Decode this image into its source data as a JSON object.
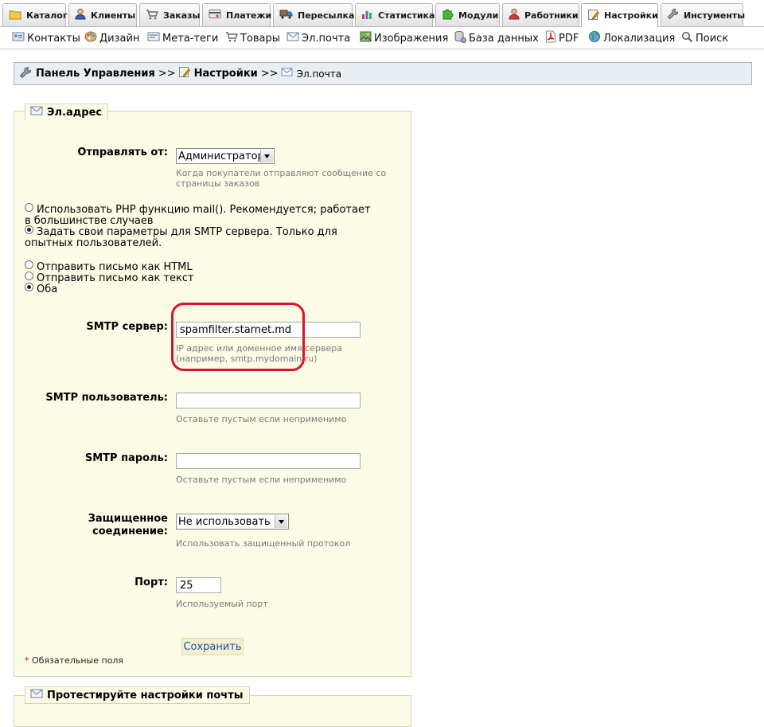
{
  "tabs": [
    {
      "label": "Каталог",
      "icon": "folder-icon"
    },
    {
      "label": "Клиенты",
      "icon": "user-icon"
    },
    {
      "label": "Заказы",
      "icon": "cart-icon"
    },
    {
      "label": "Платежи",
      "icon": "payment-icon"
    },
    {
      "label": "Пересылка",
      "icon": "truck-icon"
    },
    {
      "label": "Статистика",
      "icon": "chart-icon"
    },
    {
      "label": "Модули",
      "icon": "puzzle-icon"
    },
    {
      "label": "Работники",
      "icon": "worker-icon"
    },
    {
      "label": "Настройки",
      "icon": "settings-page-icon",
      "active": true
    },
    {
      "label": "Инстументы",
      "icon": "wrench-icon"
    }
  ],
  "submenu": [
    {
      "label": "Контакты",
      "icon": "contacts-icon"
    },
    {
      "label": "Дизайн",
      "icon": "palette-icon"
    },
    {
      "label": "Мета-теги",
      "icon": "meta-tags-icon"
    },
    {
      "label": "Товары",
      "icon": "cart-icon"
    },
    {
      "label": "Эл.почта",
      "icon": "envelope-icon"
    },
    {
      "label": "Изображения",
      "icon": "image-icon"
    },
    {
      "label": "База данных",
      "icon": "database-icon"
    },
    {
      "label": "PDF",
      "icon": "pdf-icon"
    },
    {
      "label": "Локализация",
      "icon": "globe-icon"
    },
    {
      "label": "Поиск",
      "icon": "search-icon"
    }
  ],
  "breadcrumb": {
    "root": "Панель Управления",
    "separator": ">>",
    "section": "Настройки",
    "current": "Эл.почта"
  },
  "form": {
    "legend": "Эл.адрес",
    "send_from": {
      "label": "Отправлять от:",
      "value": "Администратор",
      "hint": "Когда покупатели отправляют сообщение со страницы заказов"
    },
    "mail_method": [
      {
        "label": "Использовать PHP функцию mail(). Рекомендуется; работает в большинстве случаев",
        "checked": false
      },
      {
        "label": "Задать свои параметры для SMTP сервера. Только для опытных пользователей.",
        "checked": true
      }
    ],
    "mail_format": [
      {
        "label": "Отправить письмо как HTML",
        "checked": false
      },
      {
        "label": "Отправить письмо как текст",
        "checked": false
      },
      {
        "label": "Оба",
        "checked": true
      }
    ],
    "smtp_server": {
      "label": "SMTP сервер:",
      "value": "spamfilter.starnet.md",
      "hint": "IP адрес или доменное имя сервера (например, smtp.mydomain.ru)"
    },
    "smtp_user": {
      "label": "SMTP пользователь:",
      "value": "",
      "hint": "Оставьте пустым если неприменимо"
    },
    "smtp_password": {
      "label": "SMTP пароль:",
      "value": "",
      "hint": "Оставьте пустым если неприменимо"
    },
    "secure": {
      "label_line1": "Защищенное",
      "label_line2": "соединение:",
      "value": "Не использовать",
      "hint": "Использовать защищенный протокол"
    },
    "port": {
      "label": "Порт:",
      "value": "25",
      "hint": "Используемый порт"
    },
    "save_label": "Сохранить",
    "required_star": "*",
    "required_note": "Обязательные поля"
  },
  "test_section": {
    "legend": "Протестируйте настройки почты"
  },
  "colors": {
    "highlight": "#e0102a",
    "fieldset_bg": "#fcfbe6",
    "link_blue": "#1d4fa8"
  }
}
